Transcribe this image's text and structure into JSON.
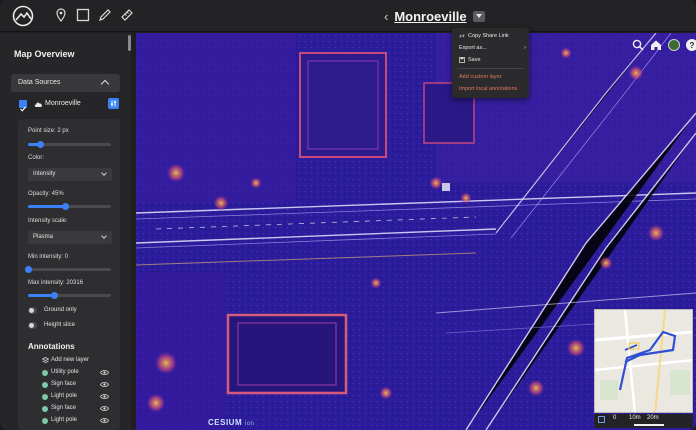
{
  "header": {
    "title": "Monroeville",
    "back_label": "‹",
    "tools": [
      "pin-icon",
      "square-select-icon",
      "pencil-icon",
      "ruler-icon"
    ]
  },
  "dropdown": {
    "items": [
      {
        "label": "Copy Share Link",
        "icon": "link-icon"
      },
      {
        "label": "Export as...",
        "icon": "",
        "has_submenu": true
      },
      {
        "label": "Save",
        "icon": "save-icon"
      },
      {
        "label": "Add custom layer",
        "icon": "",
        "warn": true
      },
      {
        "label": "Import local annotations",
        "icon": "",
        "warn": true
      }
    ],
    "submenu_chevron": "›"
  },
  "sidebar": {
    "title": "Map Overview",
    "data_sources_label": "Data Sources",
    "data_source": {
      "name": "Monroeville",
      "checked": true
    },
    "point_size": {
      "label": "Point size: 2 px",
      "value": 0.15
    },
    "color": {
      "label": "Color:",
      "selected": "Intensity"
    },
    "opacity": {
      "label": "Opacity: 45%",
      "value": 0.45
    },
    "intensity_scale": {
      "label": "Intensity scale:",
      "selected": "Plasma"
    },
    "min_intensity": {
      "label": "Min intensity: 0",
      "value": 0.0
    },
    "max_intensity": {
      "label": "Max intensity: 20316",
      "value": 0.31
    },
    "ground_only": {
      "label": "Ground only",
      "on": false
    },
    "height_slice": {
      "label": "Height slice",
      "on": false
    },
    "annotations_title": "Annotations",
    "annotations": [
      {
        "label": "Add new layer",
        "icon": "layers-icon",
        "add": true
      },
      {
        "label": "Utility pole"
      },
      {
        "label": "Sign face"
      },
      {
        "label": "Light pole"
      },
      {
        "label": "Sign face"
      },
      {
        "label": "Light pole"
      }
    ]
  },
  "map": {
    "scale_labels": [
      "0",
      "10m",
      "20m"
    ],
    "attribution": "CESIUM",
    "attribution_sub": "ion",
    "help_label": "?"
  },
  "colors": {
    "accent": "#3b82f6",
    "map_base": "#241a8c",
    "warn_text": "#e07a5f"
  }
}
